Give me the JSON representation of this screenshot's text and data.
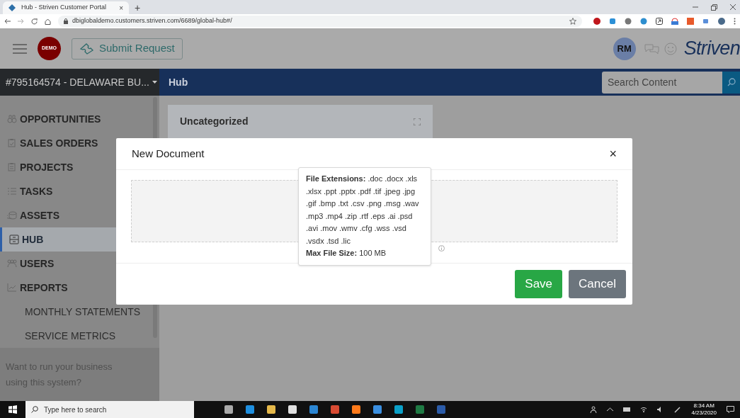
{
  "browser": {
    "tab_title": "Hub - Striven Customer Portal",
    "tab_close": "×",
    "new_tab": "+",
    "url": "dbiglobaldemo.customers.striven.com/6689/global-hub#/"
  },
  "header": {
    "badge": "DEMO",
    "submit_button": "Submit Request",
    "avatar": "RM",
    "logo": "Striven"
  },
  "navbar": {
    "account_selector": "#795164574 - DELAWARE BU...",
    "page_title": "Hub",
    "search": {
      "placeholder": "Search Content"
    }
  },
  "sidebar": {
    "items": [
      {
        "label": "OPPORTUNITIES",
        "selected": false
      },
      {
        "label": "SALES ORDERS",
        "selected": false
      },
      {
        "label": "PROJECTS",
        "selected": false
      },
      {
        "label": "TASKS",
        "selected": false
      },
      {
        "label": "ASSETS",
        "selected": false
      },
      {
        "label": "HUB",
        "selected": true
      },
      {
        "label": "USERS",
        "selected": false
      },
      {
        "label": "REPORTS",
        "selected": false
      }
    ],
    "sub_items": [
      "MONTHLY STATEMENTS",
      "SERVICE METRICS"
    ],
    "promo": "Want to run your business using this system?"
  },
  "card": {
    "title": "Uncategorized"
  },
  "modal": {
    "title": "New Document",
    "close": "×",
    "tooltip": [
      "**File Extensions:** .doc .docx .xls .xlsx .ppt .pptx .pdf .tif .jpeg .jpg .gif .bmp .txt .csv .png .msg .wav .mp3 .mp4 .zip .rtf .eps .ai .psd .avi .mov .wmv .cfg .wss .vsd .vsdx .tsd .lic",
      "**Max File Size:** 100 MB"
    ],
    "buttons": [
      {
        "label": "Save",
        "kind": "primary"
      },
      {
        "label": "Cancel",
        "kind": "secondary"
      }
    ]
  },
  "taskbar": {
    "search": {
      "placeholder": "Type here to search"
    },
    "time": "8:34 AM",
    "date": "4/23/2020"
  }
}
